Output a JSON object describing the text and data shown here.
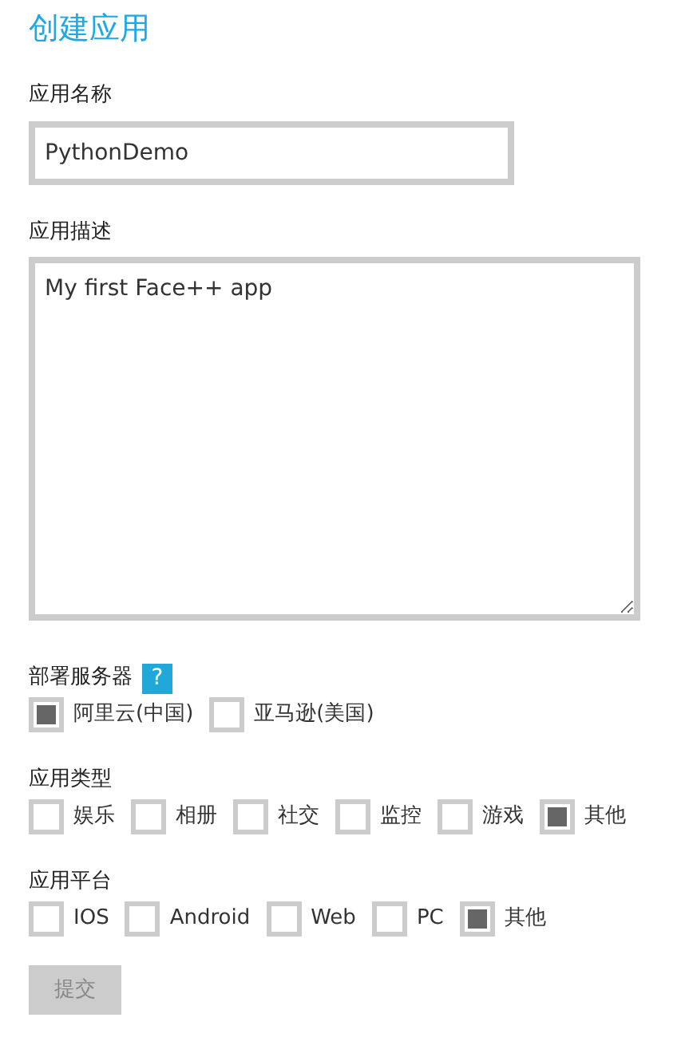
{
  "title": "创建应用",
  "name_field": {
    "label": "应用名称",
    "value": "PythonDemo"
  },
  "description_field": {
    "label": "应用描述",
    "value": "My first Face++ app"
  },
  "groups": [
    {
      "label": "部署服务器",
      "help": "?",
      "options": [
        {
          "label": "阿里云(中国)",
          "checked": true
        },
        {
          "label": "亚马逊(美国)",
          "checked": false
        }
      ]
    },
    {
      "label": "应用类型",
      "options": [
        {
          "label": "娱乐",
          "checked": false
        },
        {
          "label": "相册",
          "checked": false
        },
        {
          "label": "社交",
          "checked": false
        },
        {
          "label": "监控",
          "checked": false
        },
        {
          "label": "游戏",
          "checked": false
        },
        {
          "label": "其他",
          "checked": true
        }
      ]
    },
    {
      "label": "应用平台",
      "options": [
        {
          "label": "IOS",
          "checked": false
        },
        {
          "label": "Android",
          "checked": false
        },
        {
          "label": "Web",
          "checked": false
        },
        {
          "label": "PC",
          "checked": false
        },
        {
          "label": "其他",
          "checked": true
        }
      ]
    }
  ],
  "submit": {
    "label": "提交"
  }
}
